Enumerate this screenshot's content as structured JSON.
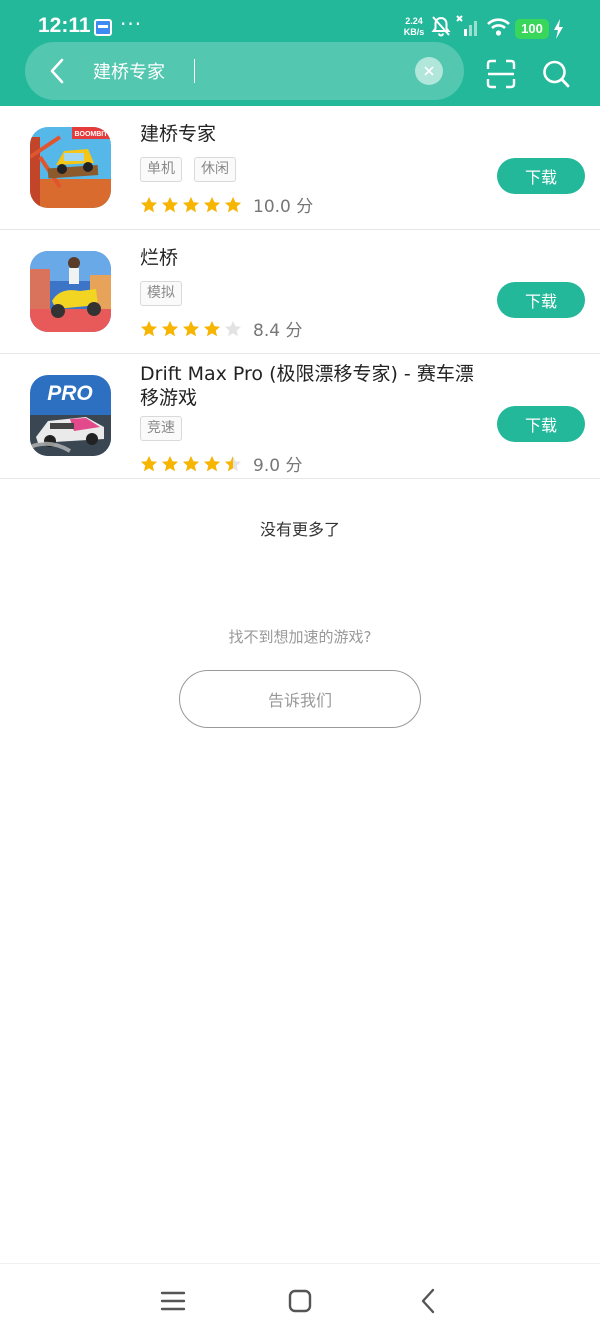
{
  "status_bar": {
    "time": "12:11",
    "net_speed_value": "2.24",
    "net_speed_unit": "KB/s",
    "battery": "100",
    "icons": [
      "app-notification-icon",
      "more-dots-icon",
      "mute-bell-icon",
      "signal-icon",
      "wifi-icon",
      "battery-icon",
      "charging-bolt-icon"
    ]
  },
  "search": {
    "query": "建桥专家",
    "icons": [
      "back-arrow-icon",
      "clear-icon",
      "scan-icon",
      "search-icon"
    ]
  },
  "results": [
    {
      "title": "建桥专家",
      "tags": [
        "单机",
        "休闲"
      ],
      "rating": 5,
      "score": "10.0 分",
      "button": "下载",
      "icon": "bridge-builder-game-icon",
      "icon_label": "BOOMBIT"
    },
    {
      "title": "烂桥",
      "tags": [
        "模拟"
      ],
      "rating": 4,
      "score": "8.4 分",
      "button": "下载",
      "icon": "scooter-game-icon"
    },
    {
      "title": "Drift Max Pro (极限漂移专家) - 赛车漂移游戏",
      "tags": [
        "竞速"
      ],
      "rating": 4.5,
      "score": "9.0 分",
      "button": "下载",
      "icon": "drift-racing-game-icon",
      "icon_label": "PRO"
    }
  ],
  "footer": {
    "no_more": "没有更多了",
    "cant_find": "找不到想加速的游戏?",
    "tell_us": "告诉我们"
  },
  "colors": {
    "brand": "#23b89a",
    "star": "#f7b500",
    "star_empty": "#e3e3e3"
  },
  "nav_bar": {
    "icons": [
      "menu-icon",
      "home-icon",
      "back-icon"
    ]
  }
}
